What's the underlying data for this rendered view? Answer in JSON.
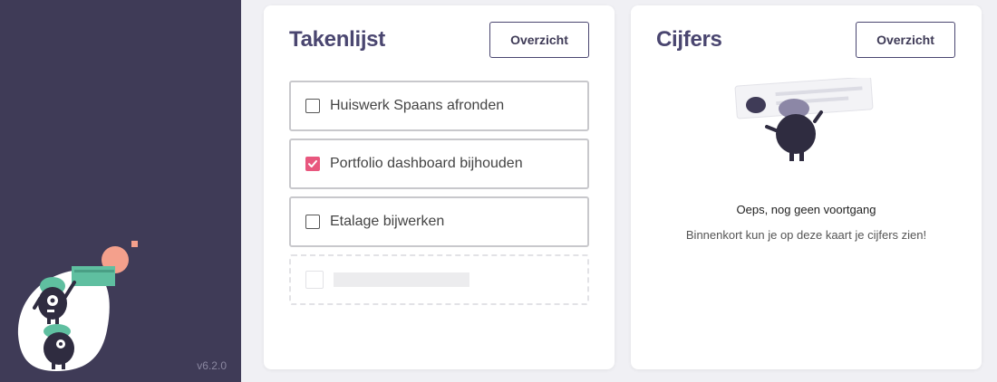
{
  "sidebar": {
    "version": "v6.2.0",
    "mascot_icon": "stacked-monsters-illustration"
  },
  "tasks_card": {
    "title": "Takenlijst",
    "button_label": "Overzicht",
    "items": [
      {
        "label": "Huiswerk Spaans afronden",
        "checked": false
      },
      {
        "label": "Portfolio dashboard bijhouden",
        "checked": true
      },
      {
        "label": "Etalage bijwerken",
        "checked": false
      }
    ],
    "check_color": "#e8577e"
  },
  "grades_card": {
    "title": "Cijfers",
    "button_label": "Overzicht",
    "empty_title": "Oeps, nog geen voortgang",
    "empty_subtitle": "Binnenkort kun je op deze kaart je cijfers zien!",
    "empty_icon": "monster-with-card-illustration"
  },
  "colors": {
    "sidebar_bg": "#3f3b57",
    "title": "#4a4670",
    "accent_pink": "#e8577e",
    "accent_teal": "#5fbfa0",
    "accent_salmon": "#f4a08c"
  }
}
